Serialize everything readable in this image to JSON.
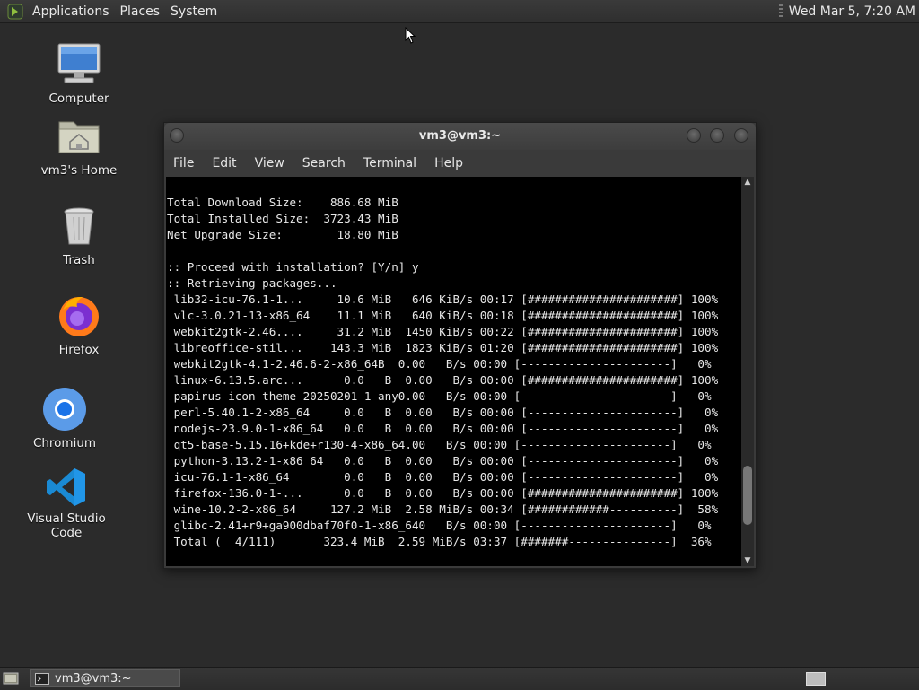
{
  "top_panel": {
    "menus": [
      "Applications",
      "Places",
      "System"
    ],
    "clock": "Wed Mar  5,  7:20 AM"
  },
  "desktop_icons": [
    {
      "label": "Computer",
      "icon": "computer-icon"
    },
    {
      "label": "vm3's Home",
      "icon": "home-folder-icon"
    },
    {
      "label": "Trash",
      "icon": "trash-icon"
    },
    {
      "label": "Firefox",
      "icon": "firefox-icon"
    },
    {
      "label": "Chromium",
      "icon": "chromium-icon"
    },
    {
      "label": "Visual Studio Code",
      "icon": "vscode-icon"
    }
  ],
  "terminal": {
    "title": "vm3@vm3:~",
    "menu": [
      "File",
      "Edit",
      "View",
      "Search",
      "Terminal",
      "Help"
    ],
    "scroll_position": 0.9,
    "lines": [
      "Total Download Size:    886.68 MiB",
      "Total Installed Size:  3723.43 MiB",
      "Net Upgrade Size:        18.80 MiB",
      "",
      ":: Proceed with installation? [Y/n] y",
      ":: Retrieving packages...",
      " lib32-icu-76.1-1...     10.6 MiB   646 KiB/s 00:17 [######################] 100%",
      " vlc-3.0.21-13-x86_64    11.1 MiB   640 KiB/s 00:18 [######################] 100%",
      " webkit2gtk-2.46....     31.2 MiB  1450 KiB/s 00:22 [######################] 100%",
      " libreoffice-stil...    143.3 MiB  1823 KiB/s 01:20 [######################] 100%",
      " webkit2gtk-4.1-2.46.6-2-x86_64B  0.00   B/s 00:00 [----------------------]   0%",
      " linux-6.13.5.arc...      0.0   B  0.00   B/s 00:00 [######################] 100%",
      " papirus-icon-theme-20250201-1-any0.00   B/s 00:00 [----------------------]   0%",
      " perl-5.40.1-2-x86_64     0.0   B  0.00   B/s 00:00 [----------------------]   0%",
      " nodejs-23.9.0-1-x86_64   0.0   B  0.00   B/s 00:00 [----------------------]   0%",
      " qt5-base-5.15.16+kde+r130-4-x86_64.00   B/s 00:00 [----------------------]   0%",
      " python-3.13.2-1-x86_64   0.0   B  0.00   B/s 00:00 [----------------------]   0%",
      " icu-76.1-1-x86_64        0.0   B  0.00   B/s 00:00 [----------------------]   0%",
      " firefox-136.0-1-...      0.0   B  0.00   B/s 00:00 [######################] 100%",
      " wine-10.2-2-x86_64     127.2 MiB  2.58 MiB/s 00:34 [############----------]  58%",
      " glibc-2.41+r9+ga900dbaf70f0-1-x86_640   B/s 00:00 [----------------------]   0%",
      " Total (  4/111)       323.4 MiB  2.59 MiB/s 03:37 [#######---------------]  36%"
    ]
  },
  "taskbar": {
    "items": [
      {
        "label": "vm3@vm3:~"
      }
    ]
  },
  "colors": {
    "desktop_bg": "#2b2b2b",
    "panel_bg": "#333333",
    "terminal_bg": "#000000",
    "terminal_fg": "#e8e8e8"
  }
}
